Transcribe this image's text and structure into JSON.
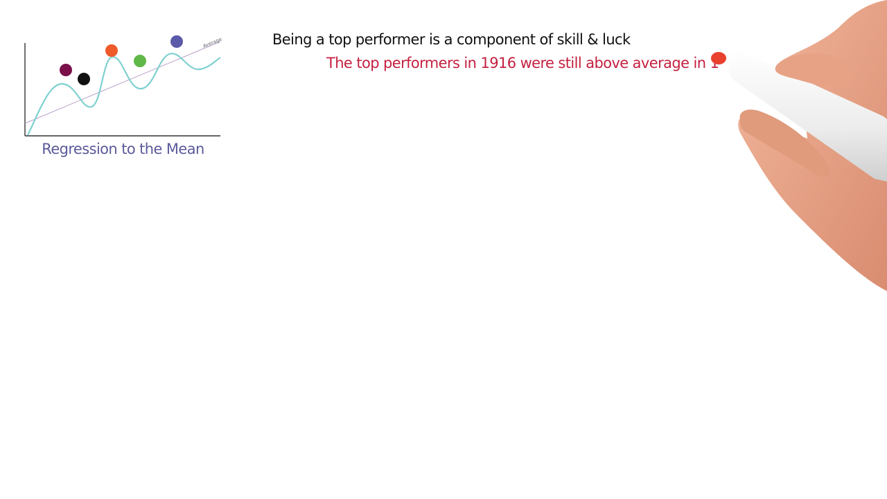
{
  "diagram": {
    "average_label": "Average",
    "caption": "Regression to the Mean",
    "colors": {
      "axis": "#333333",
      "wave": "#7fd0d0",
      "average_line": "#b9a0c8",
      "caption": "#5b5a9a"
    },
    "dots": [
      {
        "name": "maroon",
        "color": "#7a0f4a"
      },
      {
        "name": "black",
        "color": "#111111"
      },
      {
        "name": "orange",
        "color": "#ef5a2a"
      },
      {
        "name": "green",
        "color": "#5fb848"
      },
      {
        "name": "blue",
        "color": "#5b5aa8"
      }
    ]
  },
  "text": {
    "headline": "Being a top performer is a component of skill & luck",
    "headline_color": "#111111",
    "subline": "The top performers in 1916 were still above average in 1",
    "subline_color": "#c4203f"
  },
  "marker": {
    "tip_color": "#e8412e"
  }
}
